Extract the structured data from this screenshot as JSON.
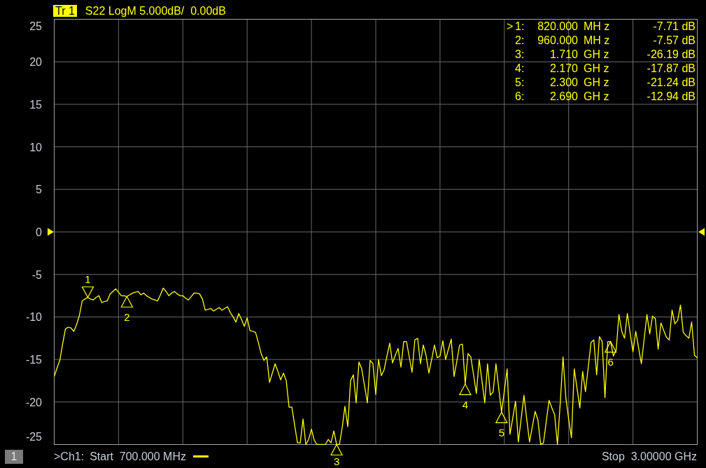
{
  "header": {
    "trace": "Tr 1",
    "settings": "S22 LogM 5.000dB/  0.00dB"
  },
  "chart_data": {
    "type": "line",
    "grid": true,
    "ylim": [
      -25,
      25
    ],
    "yticks": [
      25,
      20,
      15,
      10,
      5,
      0,
      -5,
      -10,
      -15,
      -20,
      -25
    ],
    "categories": [
      null,
      null,
      null,
      null,
      null,
      null,
      null,
      null,
      null,
      null,
      null,
      null,
      null,
      null,
      null,
      null,
      null,
      null,
      null,
      null,
      null,
      null,
      null,
      null,
      null,
      null,
      null,
      null,
      null,
      null,
      null,
      null,
      null,
      null,
      null,
      null,
      null,
      null,
      null,
      null,
      null,
      null,
      null,
      null,
      null,
      null,
      null,
      null,
      null,
      null,
      null,
      null,
      null,
      null,
      null,
      null,
      null,
      null,
      null,
      null,
      null,
      null,
      null,
      null,
      null,
      null,
      null,
      null,
      null,
      null,
      null,
      null,
      null,
      null,
      null,
      null,
      null,
      null,
      null,
      null,
      null,
      null,
      null,
      null,
      null,
      null,
      null,
      null,
      null,
      null,
      null,
      null,
      null,
      null,
      null,
      null,
      null,
      null,
      null,
      null,
      null,
      null,
      null,
      null,
      null,
      null,
      null,
      null,
      null,
      null,
      null,
      null,
      null,
      null,
      null,
      null,
      null,
      null,
      null,
      null,
      null,
      null,
      null,
      null,
      null,
      null,
      null,
      null,
      null,
      null,
      null,
      null,
      null,
      null,
      null,
      null,
      null,
      null,
      null,
      null,
      null,
      null,
      null,
      null,
      null,
      null,
      null,
      null,
      null,
      null,
      null,
      null,
      null,
      null,
      null,
      null,
      null,
      null,
      null,
      null,
      null,
      null,
      null,
      null,
      null,
      null,
      null,
      null,
      null,
      null,
      null,
      null,
      null,
      null,
      null,
      null,
      null,
      null,
      null,
      null,
      null,
      null,
      null,
      null,
      null,
      null,
      null,
      null,
      null,
      null,
      null,
      null,
      null,
      null,
      null,
      null,
      null,
      null,
      null,
      null,
      null,
      null,
      null,
      null,
      null,
      null,
      null,
      null,
      null,
      null,
      null,
      null,
      null,
      null,
      null,
      null,
      null,
      null,
      null,
      null,
      null,
      null,
      null,
      null,
      null,
      null,
      null,
      null,
      null,
      null,
      null
    ],
    "series": [
      {
        "color": "#ffff00",
        "values": [
          -17.0,
          -16.0,
          -15.1,
          -13.2,
          -11.4,
          -11.2,
          -11.3,
          -11.7,
          -10.9,
          -9.8,
          -8.1,
          -7.9,
          -7.7,
          -7.9,
          -8.0,
          -7.7,
          -7.5,
          -8.3,
          -8.2,
          -8.1,
          -7.3,
          -7.0,
          -6.7,
          -7.1,
          -7.5,
          -7.5,
          -7.6,
          -7.4,
          -7.2,
          -7.1,
          -7.0,
          -7.4,
          -7.2,
          -7.5,
          -7.7,
          -7.9,
          -8.0,
          -8.1,
          -7.4,
          -6.6,
          -7.0,
          -7.5,
          -7.2,
          -7.0,
          -7.3,
          -7.5,
          -7.5,
          -7.8,
          -8.0,
          -7.6,
          -7.2,
          -7.2,
          -7.3,
          -7.9,
          -9.2,
          -9.1,
          -9.0,
          -9.3,
          -9.1,
          -8.9,
          -9.2,
          -9.0,
          -8.8,
          -9.5,
          -10.0,
          -10.6,
          -9.6,
          -10.3,
          -11.1,
          -10.1,
          -11.6,
          -11.7,
          -11.8,
          -13.0,
          -14.3,
          -15.1,
          -14.7,
          -17.7,
          -16.6,
          -15.5,
          -16.4,
          -17.4,
          -16.6,
          -17.5,
          -20.6,
          -20.6,
          -22.7,
          -24.8,
          -24.8,
          -22.0,
          -25.0,
          -24.4,
          -23.2,
          -24.5,
          -25.0,
          -25.0,
          -25.0,
          -25.0,
          -24.4,
          -24.8,
          -23.4,
          -25.0,
          -25.0,
          -23.0,
          -20.5,
          -22.9,
          -17.5,
          -16.8,
          -20.1,
          -15.3,
          -16.1,
          -18.1,
          -20.1,
          -15.1,
          -15.5,
          -19.1,
          -15.0,
          -16.9,
          -16.2,
          -14.6,
          -13.1,
          -15.4,
          -14.5,
          -13.7,
          -15.9,
          -12.9,
          -12.9,
          -14.7,
          -16.5,
          -12.7,
          -12.5,
          -15.5,
          -13.3,
          -14.5,
          -16.6,
          -15.0,
          -13.3,
          -14.8,
          -14.6,
          -12.8,
          -15.0,
          -13.8,
          -12.6,
          -17.0,
          -15.2,
          -13.3,
          -13.2,
          -17.9,
          -14.3,
          -14.7,
          -16.8,
          -19.0,
          -15.0,
          -17.5,
          -20.1,
          -15.5,
          -19.2,
          -18.8,
          -15.5,
          -18.4,
          -21.2,
          -18.7,
          -16.1,
          -23.8,
          -21.9,
          -19.9,
          -24.7,
          -22.0,
          -19.2,
          -22.0,
          -24.7,
          -22.9,
          -21.1,
          -22.1,
          -25.0,
          -24.8,
          -22.3,
          -19.8,
          -20.7,
          -21.5,
          -25.0,
          -20.1,
          -14.7,
          -19.5,
          -22.0,
          -24.2,
          -16.1,
          -18.4,
          -20.7,
          -16.4,
          -18.8,
          -15.9,
          -13.0,
          -12.7,
          -16.8,
          -12.3,
          -12.9,
          -19.5,
          -12.9,
          -12.9,
          -14.6,
          -13.9,
          -9.7,
          -11.7,
          -12.5,
          -9.6,
          -11.9,
          -14.1,
          -11.7,
          -13.6,
          -15.5,
          -12.6,
          -9.7,
          -12.0,
          -9.9,
          -10.2,
          -13.8,
          -10.7,
          -11.6,
          -12.4,
          -12.7,
          -9.2,
          -10.8,
          -10.4,
          -8.6,
          -11.8,
          -12.2,
          -12.5,
          -10.6,
          -14.5,
          -14.8
        ]
      }
    ],
    "value_labels": [
      null,
      null,
      null,
      null,
      null,
      null,
      null,
      null,
      null,
      null,
      null,
      null,
      "1",
      null,
      null,
      null,
      null,
      null,
      null,
      null,
      null,
      null,
      null,
      null,
      null,
      null,
      "2",
      null,
      null,
      null,
      null,
      null,
      null,
      null,
      null,
      null,
      null,
      null,
      null,
      null,
      null,
      null,
      null,
      null,
      null,
      null,
      null,
      null,
      null,
      null,
      null,
      null,
      null,
      null,
      null,
      null,
      null,
      null,
      null,
      null,
      null,
      null,
      null,
      null,
      null,
      null,
      null,
      null,
      null,
      null,
      null,
      null,
      null,
      null,
      null,
      null,
      null,
      null,
      null,
      null,
      null,
      null,
      null,
      null,
      null,
      null,
      null,
      null,
      null,
      null,
      null,
      null,
      null,
      null,
      null,
      null,
      null,
      null,
      null,
      null,
      null,
      "3",
      null,
      null,
      null,
      null,
      null,
      null,
      null,
      null,
      null,
      null,
      null,
      null,
      null,
      null,
      null,
      null,
      null,
      null,
      null,
      null,
      null,
      null,
      null,
      null,
      null,
      null,
      null,
      null,
      null,
      null,
      null,
      null,
      null,
      null,
      null,
      null,
      null,
      null,
      null,
      null,
      null,
      null,
      null,
      null,
      null,
      "4",
      null,
      null,
      null,
      null,
      null,
      null,
      null,
      null,
      null,
      null,
      null,
      null,
      "5",
      null,
      null,
      null,
      null,
      null,
      null,
      null,
      null,
      null,
      null,
      null,
      null,
      null,
      null,
      null,
      null,
      null,
      null,
      null,
      null,
      null,
      null,
      null,
      null,
      null,
      null,
      null,
      null,
      null,
      null,
      null,
      null,
      null,
      null,
      null,
      null,
      null,
      null,
      "6",
      null,
      null,
      null,
      null,
      null,
      null,
      null,
      null,
      null,
      null,
      null,
      null,
      null,
      null,
      null,
      null,
      null,
      null,
      null,
      null,
      null,
      null,
      null,
      null,
      null,
      null,
      null,
      null,
      null,
      null,
      null
    ]
  },
  "marker_table": [
    {
      "prefix": ">",
      "selected": true,
      "label": "1:",
      "stimulus": "820.000",
      "unit": "MH z",
      "response": "-7.71 dB"
    },
    {
      "selected": false,
      "label": "2:",
      "stimulus": "960.000",
      "unit": "MH z",
      "response": "-7.57 dB"
    },
    {
      "selected": false,
      "label": "3:",
      "stimulus": "1.710",
      "unit": "GH z",
      "response": "-26.19 dB"
    },
    {
      "selected": false,
      "label": "4:",
      "stimulus": "2.170",
      "unit": "GH z",
      "response": "-17.87 dB"
    },
    {
      "selected": false,
      "label": "5:",
      "stimulus": "2.300",
      "unit": "GH z",
      "response": "-21.24 dB"
    },
    {
      "selected": false,
      "label": "6:",
      "stimulus": "2.690",
      "unit": "GH z",
      "response": "-12.94 dB"
    }
  ],
  "status_bar": {
    "channel_number": "1",
    "channel": ">Ch1:",
    "start": "Start  700.000 MHz",
    "stop": "Stop  3.00000 GHz"
  }
}
